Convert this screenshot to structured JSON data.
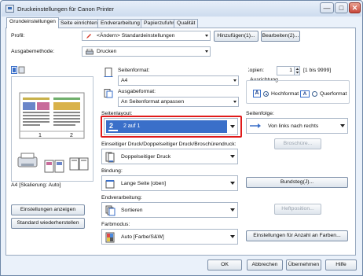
{
  "window": {
    "title": "Druckeinstellungen für Canon Printer"
  },
  "title_buttons": {
    "minimize": "—",
    "maximize": "□",
    "close": "✕"
  },
  "tabs": [
    "Grundeinstellungen",
    "Seite einrichten",
    "Endverarbeitung",
    "Papierzufuhr",
    "Qualität"
  ],
  "profile": {
    "label": "Profil:",
    "value": "<Ändern> Standardeinstellungen",
    "add_button": "Hinzufügen(1)...",
    "edit_button": "Bearbeiten(2)..."
  },
  "output": {
    "label": "Ausgabemethode:",
    "value": "Drucken"
  },
  "preview": {
    "status": "A4 [Skalierung: Auto]",
    "page_numbers": [
      "1",
      "2"
    ],
    "show_settings_button": "Einstellungen anzeigen",
    "restore_button": "Standard wiederherstellen"
  },
  "page_format": {
    "label": "Seitenformat:",
    "value": "A4"
  },
  "output_format": {
    "label": "Ausgabeformat:",
    "value": "An Seitenformat anpassen"
  },
  "copies": {
    "label": "Kopien:",
    "value": "1",
    "range": "[1 bis 9999]"
  },
  "orientation": {
    "label": "Ausrichtung",
    "portrait": "Hochformat",
    "landscape": "Querformat",
    "selected": "portrait"
  },
  "page_layout": {
    "label": "Seitenlayout:",
    "value": "2 auf 1",
    "num": "2"
  },
  "page_order": {
    "label": "Seitenfolge:",
    "value": "Von links nach rechts"
  },
  "booklet_button": "Broschüre...",
  "duplex": {
    "label": "Einseitiger Druck/Doppelseitiger Druck/Broschürendruck:",
    "value": "Doppelseitiger Druck"
  },
  "binding": {
    "label": "Bindung:",
    "value": "Lange Seite [oben]",
    "button": "Bundsteg(J)..."
  },
  "finishing": {
    "label": "Endverarbeitung:",
    "value": "Sortieren",
    "button": "Heftposition..."
  },
  "color": {
    "label": "Farbmodus:",
    "value": "Auto [Farbe/S&W]",
    "button": "Einstellungen für Anzahl an Farben..."
  },
  "footer": {
    "ok": "OK",
    "cancel": "Abbrechen",
    "apply": "Übernehmen",
    "help": "Hilfe"
  },
  "colors": {
    "highlight": "#e01a1a",
    "selection": "#3a6fc9",
    "window_bg": "#eaf1fa"
  }
}
